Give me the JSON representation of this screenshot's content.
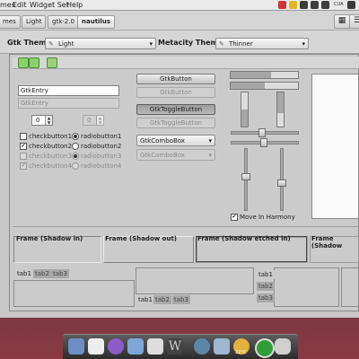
{
  "menubar": {
    "items": [
      "mes",
      "Edit",
      "Widget Set",
      "Help"
    ],
    "tray_text": "CUA",
    "tray_icons": [
      "bell-icon",
      "mail-icon",
      "network-icon",
      "keyboard-icon",
      "battery-icon",
      "speaker-icon",
      "clock-icon"
    ]
  },
  "breadcrumbs": {
    "items": [
      "mes",
      "Light",
      "gtk-2.0",
      "nautilus"
    ],
    "active_index": 3,
    "view_buttons": [
      "icon-view-icon",
      "list-view-icon"
    ]
  },
  "theme_bar": {
    "gtk_label": "Gtk Theme:",
    "gtk_value": "Light",
    "metacity_label": "Metacity Theme:",
    "metacity_value": "Thinner"
  },
  "preview": {
    "entry_value": "GtkEntry",
    "entry_disabled_value": "GtkEntry",
    "spin_value": "0",
    "spin_disabled_value": "0",
    "checks": [
      {
        "label": "checkbutton1",
        "checked": false
      },
      {
        "label": "checkbutton2",
        "checked": true
      },
      {
        "label": "checkbutton3",
        "checked": false
      },
      {
        "label": "checkbutton4",
        "checked": true
      }
    ],
    "radios": [
      {
        "label": "radiobutton1",
        "checked": true
      },
      {
        "label": "radiobutton2",
        "checked": false
      },
      {
        "label": "radiobutton3",
        "checked": true
      },
      {
        "label": "radiobutton4",
        "checked": false
      }
    ],
    "button": "GtkButton",
    "button_disabled": "GtkButton",
    "toggle": "GtkToggleButton",
    "toggle_disabled": "GtkToggleButton",
    "combo": "GtkComboBox",
    "combo_disabled": "GtkComboBox",
    "move_in_harmony": "Move In Harmony",
    "hprogress_1": 0.6,
    "hprogress_2": 0.5,
    "vprogress_1": 0.5,
    "vprogress_2": 0.6,
    "frames": [
      "Frame (Shadow in)",
      "Frame (Shadow out)",
      "Frame (Shadow etched in)",
      "Frame (Shadow"
    ],
    "tabs": [
      "tab1",
      "tab2",
      "tab3"
    ]
  },
  "dock": {
    "temperature": "22°C",
    "icons": [
      "finder-icon",
      "calendar-icon",
      "itunes-icon",
      "folder-icon",
      "textedit-icon",
      "w-icon",
      "time-machine-icon",
      "photos-icon",
      "weather-icon",
      "green-circle-icon",
      "robot-icon"
    ]
  }
}
